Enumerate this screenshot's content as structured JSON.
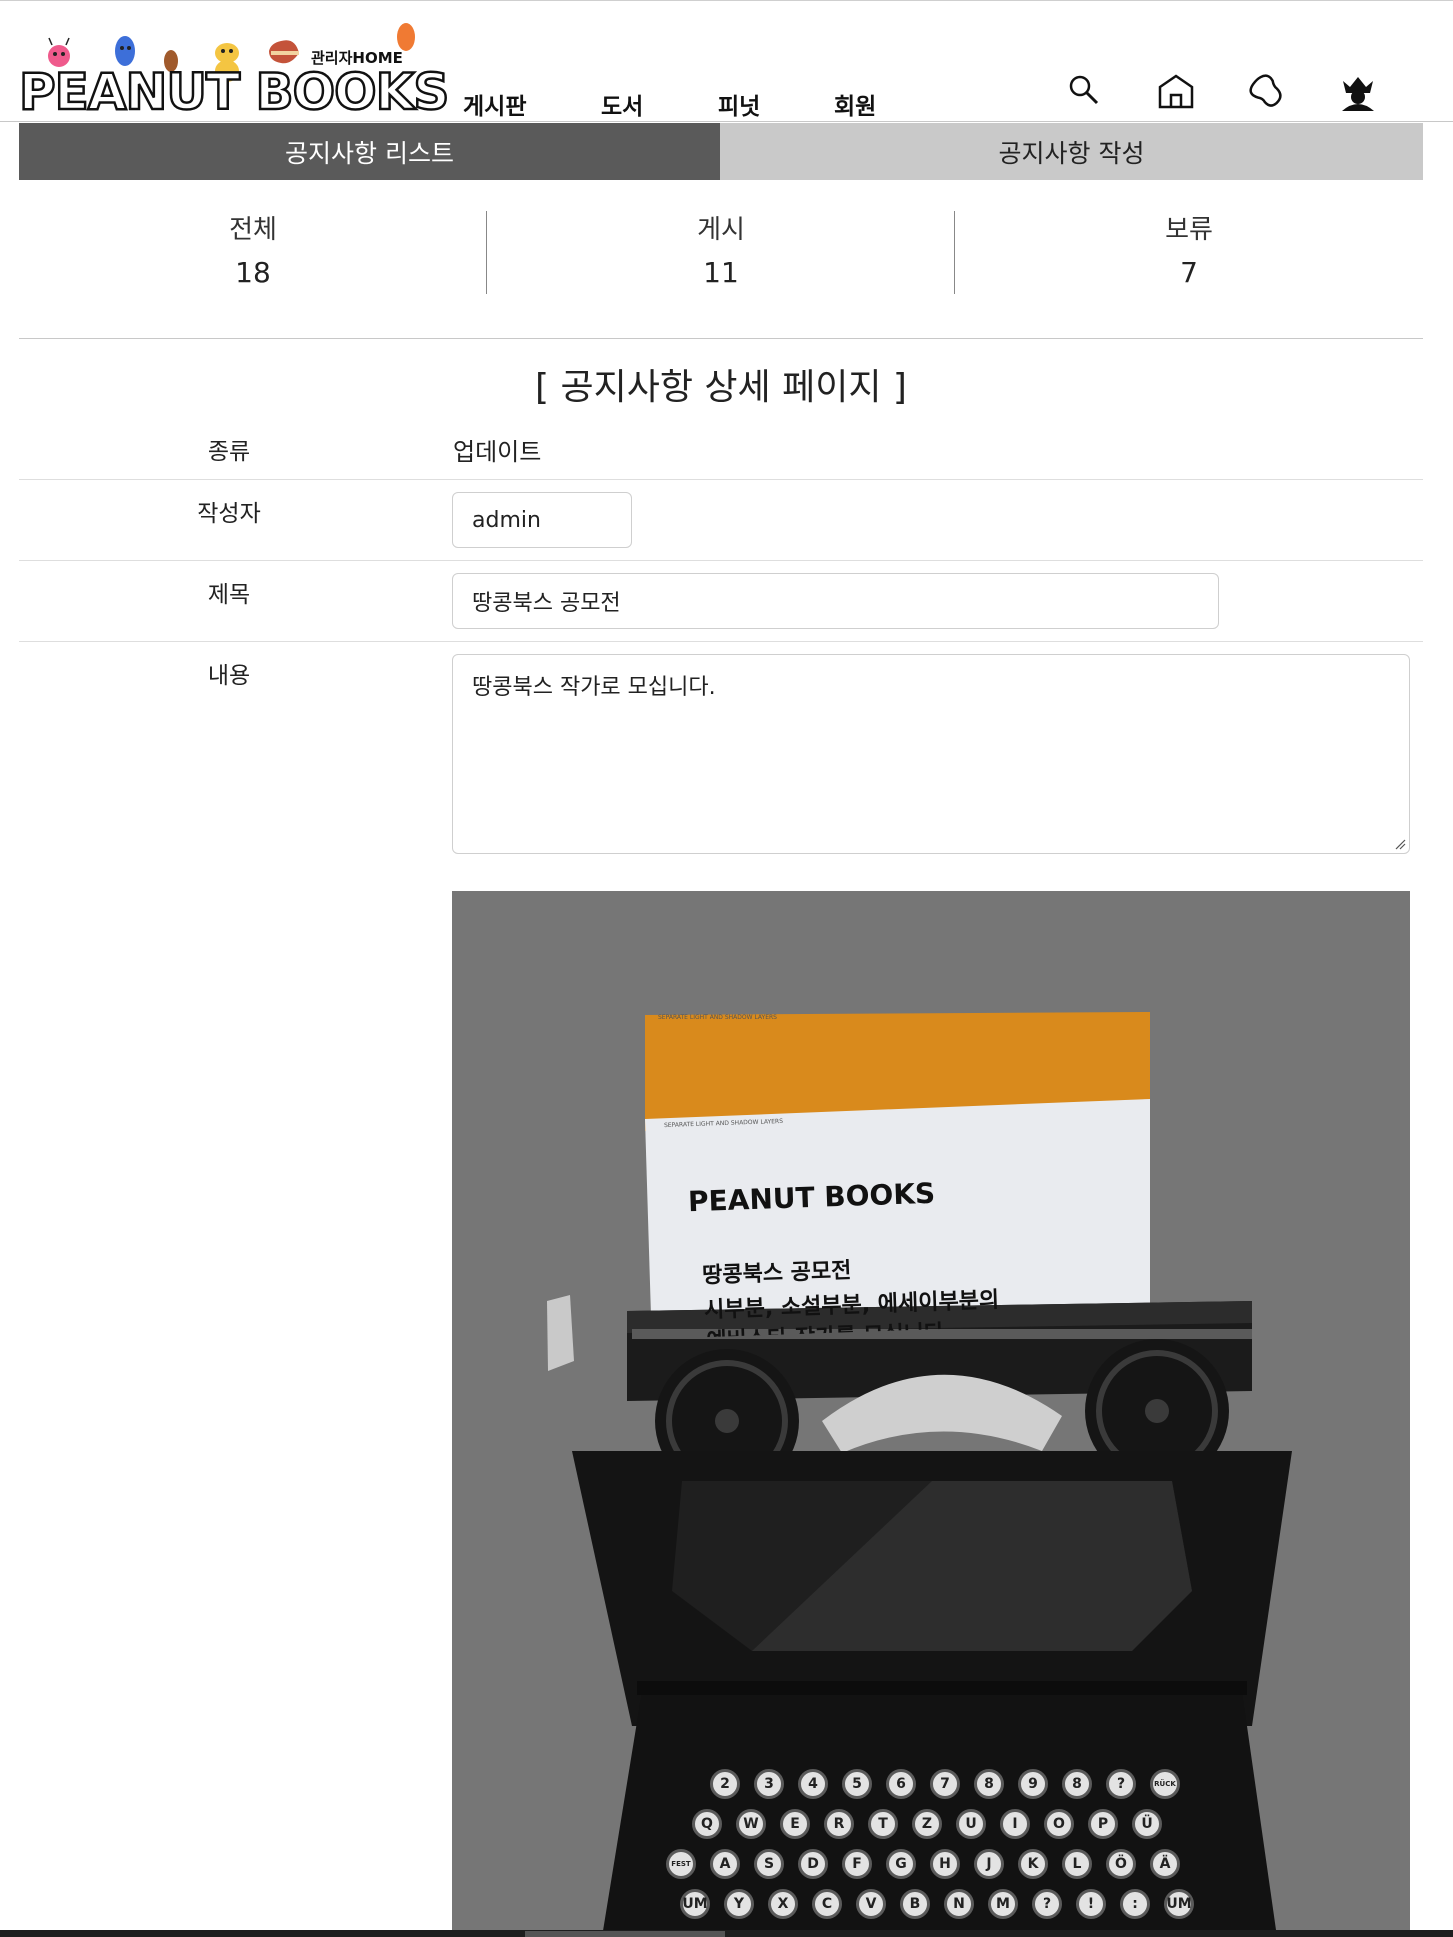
{
  "header": {
    "logo_text": "PEANUT BOOKS",
    "admin_home": "관리자HOME",
    "nav": [
      "게시판",
      "도서",
      "피넛",
      "회원"
    ],
    "icons": [
      "search-icon",
      "home-icon",
      "peanut-icon",
      "admin-crown-icon"
    ]
  },
  "tabs": {
    "list": "공지사항 리스트",
    "write": "공지사항 작성"
  },
  "stats": [
    {
      "label": "전체",
      "value": "18"
    },
    {
      "label": "게시",
      "value": "11"
    },
    {
      "label": "보류",
      "value": "7"
    }
  ],
  "detail": {
    "heading": "[ 공지사항 상세 페이지 ]",
    "type_label": "종류",
    "type_value": "업데이트",
    "author_label": "작성자",
    "author_value": "admin",
    "title_label": "제목",
    "title_value": "땅콩북스 공모전",
    "content_label": "내용",
    "content_value": "땅콩북스 작가로 모십니다."
  },
  "poster": {
    "small_caption": "SEPARATE LIGHT AND SHADOW LAYERS",
    "logo": "PEANUT BOOKS",
    "line1": "땅콩북스 공모전",
    "line2": "시부분, 소설부분, 에세이부분의",
    "line3": "예비스타 작가를 모십니다",
    "keys_row1": [
      "2",
      "3",
      "4",
      "5",
      "6",
      "7",
      "8",
      "9",
      "8",
      "?",
      "RÜCK"
    ],
    "keys_row2": [
      "Q",
      "W",
      "E",
      "R",
      "T",
      "Z",
      "U",
      "I",
      "O",
      "P",
      "Ü"
    ],
    "keys_row3": [
      "FEST",
      "A",
      "S",
      "D",
      "F",
      "G",
      "H",
      "J",
      "K",
      "L",
      "Ö",
      "Ä"
    ],
    "keys_row4": [
      "UM",
      "Y",
      "X",
      "C",
      "V",
      "B",
      "N",
      "M",
      "?",
      "!",
      ":",
      "UM"
    ]
  },
  "colors": {
    "tab_active": "#5a5a5a",
    "tab_inactive": "#c9c9c9",
    "poster_bg": "#767676",
    "paper_orange": "#d98a1c"
  }
}
